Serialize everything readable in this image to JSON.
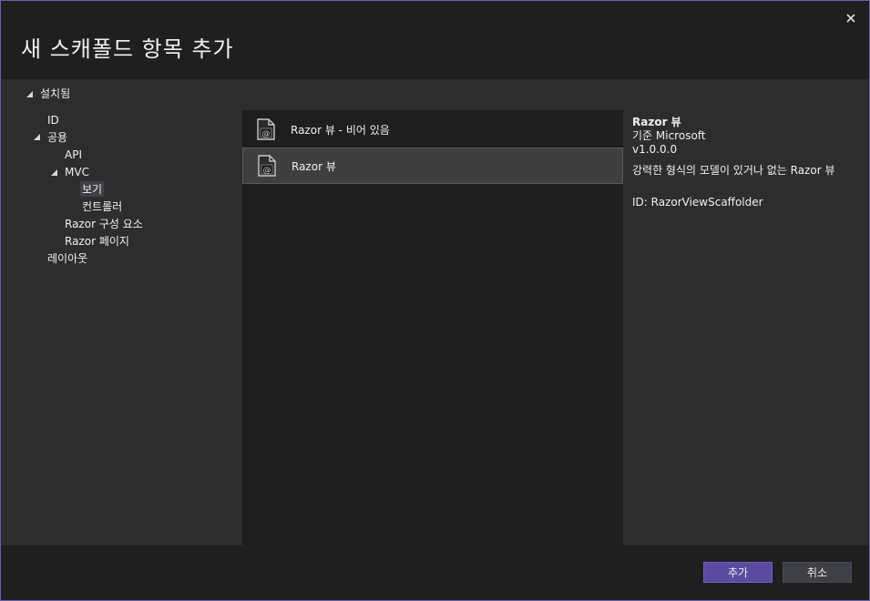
{
  "dialog": {
    "title": "새 스캐폴드 항목 추가",
    "close_icon": "close-icon"
  },
  "tree": {
    "root_label": "설치됨",
    "items": [
      {
        "label": "ID",
        "level": 1,
        "expanded": null,
        "selected": false
      },
      {
        "label": "공용",
        "level": 1,
        "expanded": true,
        "selected": false
      },
      {
        "label": "API",
        "level": 2,
        "expanded": null,
        "selected": false
      },
      {
        "label": "MVC",
        "level": 2,
        "expanded": true,
        "selected": false
      },
      {
        "label": "보기",
        "level": 3,
        "expanded": null,
        "selected": true
      },
      {
        "label": "컨트롤러",
        "level": 3,
        "expanded": null,
        "selected": false
      },
      {
        "label": "Razor 구성 요소",
        "level": 2,
        "expanded": null,
        "selected": false
      },
      {
        "label": "Razor 페이지",
        "level": 2,
        "expanded": null,
        "selected": false
      },
      {
        "label": "레이아웃",
        "level": 1,
        "expanded": null,
        "selected": false
      }
    ]
  },
  "templates": [
    {
      "label": "Razor 뷰 - 비어 있음",
      "icon": "razor-file-icon",
      "selected": false
    },
    {
      "label": "Razor 뷰",
      "icon": "razor-file-icon",
      "selected": true
    }
  ],
  "details": {
    "name": "Razor 뷰",
    "author": "기준 Microsoft",
    "version": "v1.0.0.0",
    "description": "강력한 형식의 모델이 있거나 없는 Razor 뷰",
    "id": "ID: RazorViewScaffolder"
  },
  "footer": {
    "add_label": "추가",
    "cancel_label": "취소"
  },
  "colors": {
    "accent": "#5b4ba0",
    "border": "#6b5eae",
    "panel": "#2d2d2d",
    "list_bg": "#1e1e1e"
  }
}
